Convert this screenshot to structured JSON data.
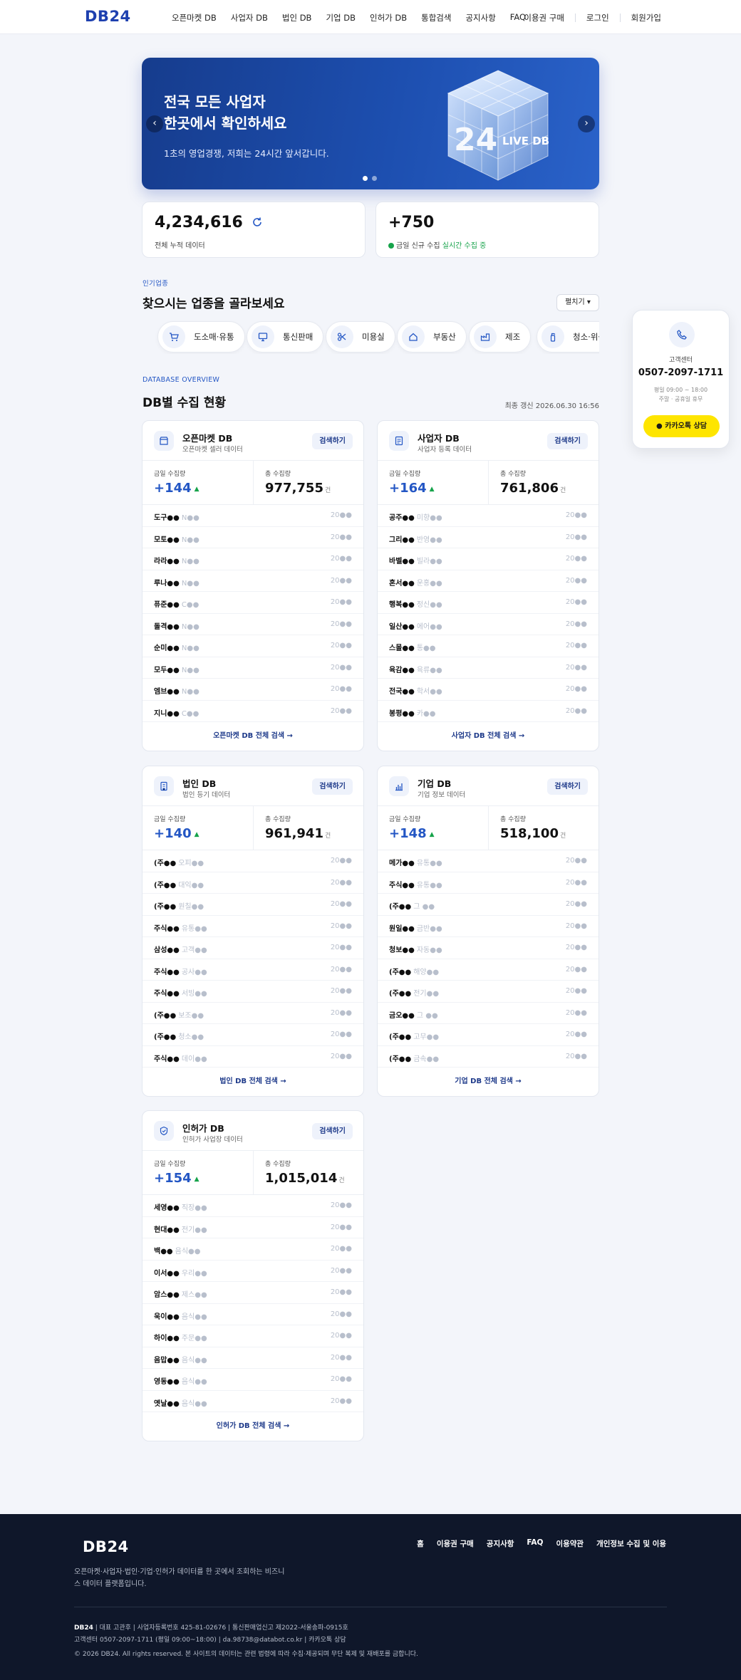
{
  "header": {
    "logo": "DB24",
    "nav": [
      "오픈마켓 DB",
      "사업자 DB",
      "법인 DB",
      "기업 DB",
      "인허가 DB",
      "통합검색",
      "공지사항",
      "FAQ"
    ],
    "right": [
      "이용권 구매",
      "로그인",
      "회원가입"
    ]
  },
  "hero": {
    "line1": "전국 모든 사업자",
    "line2": "한곳에서 확인하세요",
    "sub": "1초의 영업경쟁, 저희는 24시간 앞서갑니다.",
    "prev": "‹",
    "next": "›",
    "cube_text": "24",
    "cube_sub": "LIVE DB"
  },
  "stats": {
    "total": "4,234,616",
    "total_label": "전체 누적 데이터",
    "today": "+750",
    "today_label": "금일 신규 수집",
    "today_live": "실시간 수집 중"
  },
  "industry": {
    "eyebrow": "인기업종",
    "title": "찾으시는 업종을 골라보세요",
    "fold": "펼치기 ▾",
    "items": [
      "도소매·유통",
      "통신판매",
      "미용실",
      "부동산",
      "제조",
      "청소·위생"
    ]
  },
  "overview": {
    "eyebrow": "DATABASE OVERVIEW",
    "title": "DB별 수집 현황",
    "updated": "최종 갱신 2026.06.30 16:56"
  },
  "common": {
    "search_btn": "검색하기",
    "today_label": "금일 수집량",
    "total_label": "총 수집량",
    "unit": "건",
    "up": "▲",
    "date": "20●●"
  },
  "cards": [
    {
      "title": "오픈마켓 DB",
      "sub": "오픈마켓 셀러 데이터",
      "today": "+144",
      "total": "977,755",
      "footer": "오픈마켓 DB 전체 검색 →",
      "rows": [
        [
          "도구●●",
          "N●●"
        ],
        [
          "모토●●",
          "N●●"
        ],
        [
          "라라●●",
          "N●●"
        ],
        [
          "루나●●",
          "N●●"
        ],
        [
          "퓨준●●",
          "C●●"
        ],
        [
          "돌격●●",
          "N●●"
        ],
        [
          "순미●●",
          "N●●"
        ],
        [
          "모두●●",
          "N●●"
        ],
        [
          "엠브●●",
          "N●●"
        ],
        [
          "지니●●",
          "C●●"
        ]
      ]
    },
    {
      "title": "사업자 DB",
      "sub": "사업자 등록 데이터",
      "today": "+164",
      "total": "761,806",
      "footer": "사업자 DB 전체 검색 →",
      "rows": [
        [
          "공주●●",
          "미향●●"
        ],
        [
          "그리●●",
          "반영●●"
        ],
        [
          "바벨●●",
          "빌라●●"
        ],
        [
          "혼서●●",
          "운홍●●"
        ],
        [
          "행복●●",
          "정신●●"
        ],
        [
          "일산●●",
          "에어●●"
        ],
        [
          "스몰●●",
          "통●●"
        ],
        [
          "육감●●",
          "육류●●"
        ],
        [
          "전국●●",
          "학서●●"
        ],
        [
          "봉평●●",
          "카●●"
        ]
      ]
    },
    {
      "title": "법인 DB",
      "sub": "법인 등기 데이터",
      "today": "+140",
      "total": "961,941",
      "footer": "법인 DB 전체 검색 →",
      "rows": [
        [
          "(주●●",
          "오피●●"
        ],
        [
          "(주●●",
          "대익●●"
        ],
        [
          "(주●●",
          "원칠●●"
        ],
        [
          "주식●●",
          "유통●●"
        ],
        [
          "삼성●●",
          "고객●●"
        ],
        [
          "주식●●",
          "공사●●"
        ],
        [
          "주식●●",
          "서빙●●"
        ],
        [
          "(주●●",
          "보조●●"
        ],
        [
          "(주●●",
          "청소●●"
        ],
        [
          "주식●●",
          "데이●●"
        ]
      ]
    },
    {
      "title": "기업 DB",
      "sub": "기업 정보 데이터",
      "today": "+148",
      "total": "518,100",
      "footer": "기업 DB 전체 검색 →",
      "rows": [
        [
          "메가●●",
          "유통●●"
        ],
        [
          "주식●●",
          "유통●●"
        ],
        [
          "(주●●",
          "그 ●●"
        ],
        [
          "원일●●",
          "금반●●"
        ],
        [
          "청보●●",
          "자동●●"
        ],
        [
          "(주●●",
          "해양●●"
        ],
        [
          "(주●●",
          "전기●●"
        ],
        [
          "금오●●",
          "그 ●●"
        ],
        [
          "(주●●",
          "고무●●"
        ],
        [
          "(주●●",
          "금속●●"
        ]
      ]
    },
    {
      "title": "인허가 DB",
      "sub": "인허가 사업장 데이터",
      "today": "+154",
      "total": "1,015,014",
      "footer": "인허가 DB 전체 검색 →",
      "rows": [
        [
          "세영●●",
          "직장●●"
        ],
        [
          "현대●●",
          "전기●●"
        ],
        [
          "백●●",
          "음식●●"
        ],
        [
          "이서●●",
          "우리●●"
        ],
        [
          "암스●●",
          "제스●●"
        ],
        [
          "욱이●●",
          "음식●●"
        ],
        [
          "하이●●",
          "주문●●"
        ],
        [
          "음맙●●",
          "음식●●"
        ],
        [
          "영동●●",
          "음식●●"
        ],
        [
          "옛날●●",
          "음식●●"
        ]
      ]
    }
  ],
  "side": {
    "label": "고객센터",
    "phone": "0507-2097-1711",
    "hours": "평일 09:00 ~ 18:00",
    "holiday": "주말 · 공휴일 휴무",
    "kakao": "카카오톡 상담"
  },
  "footer": {
    "logo": "DB24",
    "desc": "오픈마켓·사업자·법인·기업·인허가 데이터를 한 곳에서 조회하는 비즈니스 데이터 플랫폼입니다.",
    "links": [
      "홈",
      "이용권 구매",
      "공지사항",
      "FAQ",
      "이용약관",
      "개인정보 수집 및 이용"
    ],
    "brand": "DB24",
    "info1": " | 대표 고관후 | 사업자등록번호 425-81-02676 | 통신판매업신고 제2022-서울송파-0915호",
    "info2": "고객센터 0507-2097-1711 (평일 09:00~18:00) | da.98738@databot.co.kr | 카카오톡 상담",
    "copy": "© 2026 DB24. All rights reserved. 본 사이트의 데이터는 관련 법령에 따라 수집·제공되며 무단 복제 및 재배포를 금합니다."
  },
  "colors": {
    "primary": "#1e40af",
    "accent": "#2356c4",
    "green": "#16a34a",
    "kakao": "#fee500",
    "footer": "#0f172a"
  }
}
